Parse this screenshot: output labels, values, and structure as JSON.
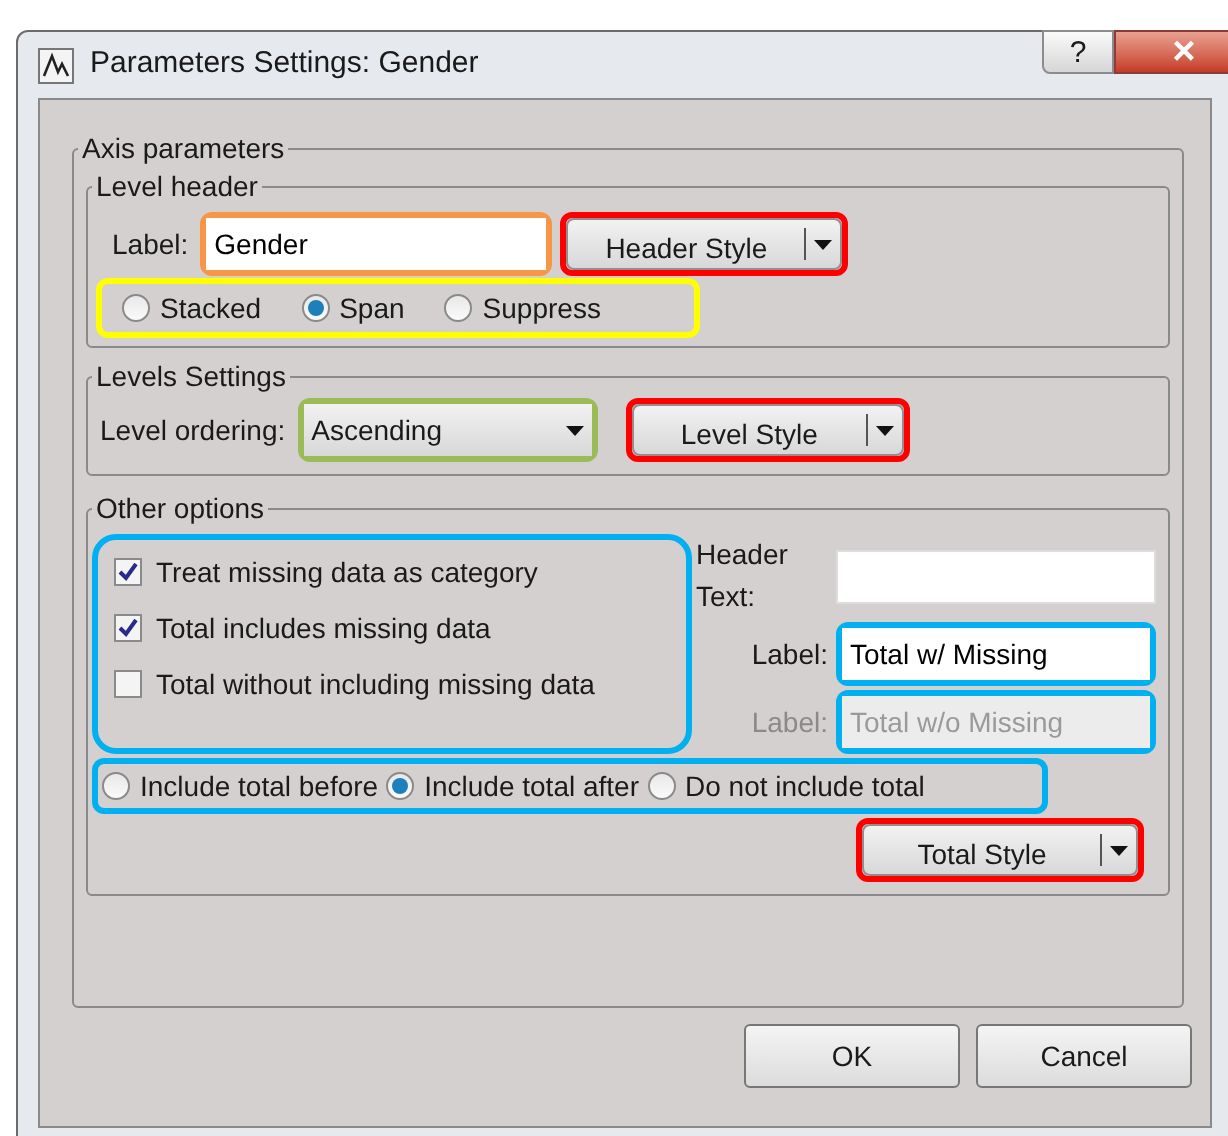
{
  "window": {
    "title": "Parameters Settings: Gender",
    "help": "?",
    "close": "×"
  },
  "axis_parameters": {
    "title": "Axis parameters",
    "level_header": {
      "title": "Level header",
      "label": "Label:",
      "field": {
        "value": "Gender",
        "color": "#f79646"
      },
      "style_button": {
        "label": "Header Style",
        "color": "#ff0000"
      },
      "layout_options": {
        "color": "#ffff00",
        "options": [
          {
            "label": "Stacked",
            "selected": false
          },
          {
            "label": "Span",
            "selected": true
          },
          {
            "label": "Suppress",
            "selected": false
          }
        ]
      }
    },
    "levels_settings": {
      "title": "Levels Settings",
      "label": "Level ordering:",
      "ordering": {
        "value": "Ascending",
        "color": "#9bbb59"
      },
      "style_button": {
        "label": "Level Style",
        "color": "#ff0000"
      }
    },
    "other_options": {
      "title": "Other options",
      "missing_options": {
        "color": "#00b0f0",
        "items": [
          {
            "label": "Treat missing data as category",
            "checked": true
          },
          {
            "label": "Total includes missing data",
            "checked": true
          },
          {
            "label": "Total without including missing data",
            "checked": false
          }
        ]
      },
      "header_text": {
        "label": "Header Text:"
      },
      "total_label": {
        "label": "Label:",
        "value": "Total w/ Missing",
        "disabled": false,
        "color": "#00b0f0"
      },
      "total_without_label": {
        "label": "Label:",
        "value": "Total w/o Missing",
        "disabled": true,
        "color": "#00b0f0"
      },
      "total_position": {
        "color": "#00b0f0",
        "options": [
          {
            "label": "Include total before",
            "selected": false
          },
          {
            "label": "Include total after",
            "selected": true
          },
          {
            "label": "Do not include total",
            "selected": false
          }
        ]
      },
      "style_button": {
        "label": "Total Style",
        "color": "#ff0000"
      }
    }
  },
  "buttons": [
    {
      "label": "OK"
    },
    {
      "label": "Cancel"
    }
  ]
}
